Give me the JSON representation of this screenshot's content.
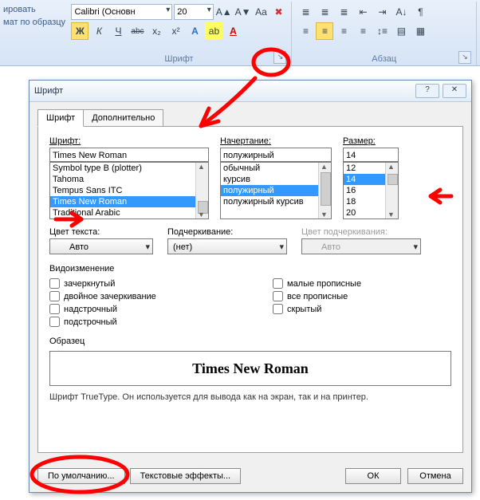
{
  "ribbon": {
    "left": {
      "line1": "ировать",
      "line2": "мат по образцу"
    },
    "font_group": {
      "caption": "Шрифт",
      "font_name": "Calibri (Основн",
      "font_size": "20",
      "row2": {
        "b": "Ж",
        "i": "К",
        "u": "Ч",
        "strike": "abc",
        "sub": "x₂",
        "sup": "x²"
      }
    },
    "para_group": {
      "caption": "Абзац"
    }
  },
  "dialog": {
    "title": "Шрифт",
    "help": "?",
    "close": "✕",
    "tabs": {
      "font": "Шрифт",
      "adv": "Дополнительно"
    },
    "font": {
      "label": "Шрифт:",
      "value": "Times New Roman",
      "list": [
        "Symbol type B (plotter)",
        "Tahoma",
        "Tempus Sans ITC",
        "Times New Roman",
        "Traditional Arabic"
      ],
      "selected_index": 3
    },
    "style": {
      "label": "Начертание:",
      "value": "полужирный",
      "list": [
        "обычный",
        "курсив",
        "полужирный",
        "полужирный курсив"
      ],
      "selected_index": 2
    },
    "size": {
      "label": "Размер:",
      "value": "14",
      "list": [
        "12",
        "14",
        "16",
        "18",
        "20"
      ],
      "selected_index": 1
    },
    "color": {
      "label": "Цвет текста:",
      "value": "Авто"
    },
    "underline": {
      "label": "Подчеркивание:",
      "value": "(нет)"
    },
    "ucolor": {
      "label": "Цвет подчеркивания:",
      "value": "Авто"
    },
    "effects": {
      "title": "Видоизменение",
      "left": [
        "зачеркнутый",
        "двойное зачеркивание",
        "надстрочный",
        "подстрочный"
      ],
      "right": [
        "малые прописные",
        "все прописные",
        "скрытый"
      ]
    },
    "preview": {
      "title": "Образец",
      "text": "Times New Roman"
    },
    "desc": "Шрифт TrueType. Он используется для вывода как на экран, так и на принтер.",
    "buttons": {
      "default": "По умолчанию...",
      "text_effects": "Текстовые эффекты...",
      "ok": "ОК",
      "cancel": "Отмена"
    }
  }
}
